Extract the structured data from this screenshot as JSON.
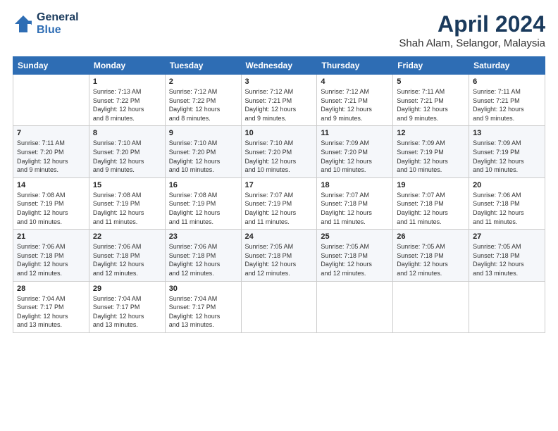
{
  "header": {
    "logo_line1": "General",
    "logo_line2": "Blue",
    "title": "April 2024",
    "location": "Shah Alam, Selangor, Malaysia"
  },
  "weekdays": [
    "Sunday",
    "Monday",
    "Tuesday",
    "Wednesday",
    "Thursday",
    "Friday",
    "Saturday"
  ],
  "weeks": [
    [
      {
        "day": "",
        "info": ""
      },
      {
        "day": "1",
        "info": "Sunrise: 7:13 AM\nSunset: 7:22 PM\nDaylight: 12 hours\nand 8 minutes."
      },
      {
        "day": "2",
        "info": "Sunrise: 7:12 AM\nSunset: 7:22 PM\nDaylight: 12 hours\nand 8 minutes."
      },
      {
        "day": "3",
        "info": "Sunrise: 7:12 AM\nSunset: 7:21 PM\nDaylight: 12 hours\nand 9 minutes."
      },
      {
        "day": "4",
        "info": "Sunrise: 7:12 AM\nSunset: 7:21 PM\nDaylight: 12 hours\nand 9 minutes."
      },
      {
        "day": "5",
        "info": "Sunrise: 7:11 AM\nSunset: 7:21 PM\nDaylight: 12 hours\nand 9 minutes."
      },
      {
        "day": "6",
        "info": "Sunrise: 7:11 AM\nSunset: 7:21 PM\nDaylight: 12 hours\nand 9 minutes."
      }
    ],
    [
      {
        "day": "7",
        "info": "Sunrise: 7:11 AM\nSunset: 7:20 PM\nDaylight: 12 hours\nand 9 minutes."
      },
      {
        "day": "8",
        "info": "Sunrise: 7:10 AM\nSunset: 7:20 PM\nDaylight: 12 hours\nand 9 minutes."
      },
      {
        "day": "9",
        "info": "Sunrise: 7:10 AM\nSunset: 7:20 PM\nDaylight: 12 hours\nand 10 minutes."
      },
      {
        "day": "10",
        "info": "Sunrise: 7:10 AM\nSunset: 7:20 PM\nDaylight: 12 hours\nand 10 minutes."
      },
      {
        "day": "11",
        "info": "Sunrise: 7:09 AM\nSunset: 7:20 PM\nDaylight: 12 hours\nand 10 minutes."
      },
      {
        "day": "12",
        "info": "Sunrise: 7:09 AM\nSunset: 7:19 PM\nDaylight: 12 hours\nand 10 minutes."
      },
      {
        "day": "13",
        "info": "Sunrise: 7:09 AM\nSunset: 7:19 PM\nDaylight: 12 hours\nand 10 minutes."
      }
    ],
    [
      {
        "day": "14",
        "info": "Sunrise: 7:08 AM\nSunset: 7:19 PM\nDaylight: 12 hours\nand 10 minutes."
      },
      {
        "day": "15",
        "info": "Sunrise: 7:08 AM\nSunset: 7:19 PM\nDaylight: 12 hours\nand 11 minutes."
      },
      {
        "day": "16",
        "info": "Sunrise: 7:08 AM\nSunset: 7:19 PM\nDaylight: 12 hours\nand 11 minutes."
      },
      {
        "day": "17",
        "info": "Sunrise: 7:07 AM\nSunset: 7:19 PM\nDaylight: 12 hours\nand 11 minutes."
      },
      {
        "day": "18",
        "info": "Sunrise: 7:07 AM\nSunset: 7:18 PM\nDaylight: 12 hours\nand 11 minutes."
      },
      {
        "day": "19",
        "info": "Sunrise: 7:07 AM\nSunset: 7:18 PM\nDaylight: 12 hours\nand 11 minutes."
      },
      {
        "day": "20",
        "info": "Sunrise: 7:06 AM\nSunset: 7:18 PM\nDaylight: 12 hours\nand 11 minutes."
      }
    ],
    [
      {
        "day": "21",
        "info": "Sunrise: 7:06 AM\nSunset: 7:18 PM\nDaylight: 12 hours\nand 12 minutes."
      },
      {
        "day": "22",
        "info": "Sunrise: 7:06 AM\nSunset: 7:18 PM\nDaylight: 12 hours\nand 12 minutes."
      },
      {
        "day": "23",
        "info": "Sunrise: 7:06 AM\nSunset: 7:18 PM\nDaylight: 12 hours\nand 12 minutes."
      },
      {
        "day": "24",
        "info": "Sunrise: 7:05 AM\nSunset: 7:18 PM\nDaylight: 12 hours\nand 12 minutes."
      },
      {
        "day": "25",
        "info": "Sunrise: 7:05 AM\nSunset: 7:18 PM\nDaylight: 12 hours\nand 12 minutes."
      },
      {
        "day": "26",
        "info": "Sunrise: 7:05 AM\nSunset: 7:18 PM\nDaylight: 12 hours\nand 12 minutes."
      },
      {
        "day": "27",
        "info": "Sunrise: 7:05 AM\nSunset: 7:18 PM\nDaylight: 12 hours\nand 13 minutes."
      }
    ],
    [
      {
        "day": "28",
        "info": "Sunrise: 7:04 AM\nSunset: 7:17 PM\nDaylight: 12 hours\nand 13 minutes."
      },
      {
        "day": "29",
        "info": "Sunrise: 7:04 AM\nSunset: 7:17 PM\nDaylight: 12 hours\nand 13 minutes."
      },
      {
        "day": "30",
        "info": "Sunrise: 7:04 AM\nSunset: 7:17 PM\nDaylight: 12 hours\nand 13 minutes."
      },
      {
        "day": "",
        "info": ""
      },
      {
        "day": "",
        "info": ""
      },
      {
        "day": "",
        "info": ""
      },
      {
        "day": "",
        "info": ""
      }
    ]
  ]
}
